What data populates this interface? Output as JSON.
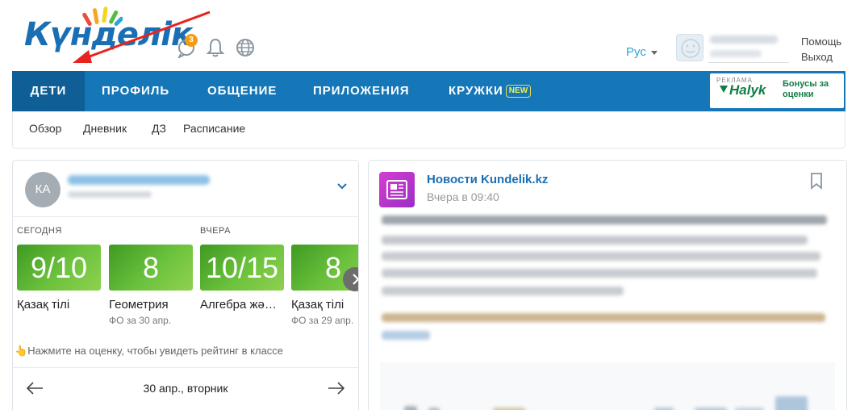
{
  "header": {
    "logo_text": "Күнделік",
    "notification_count": "3",
    "language": "Рус",
    "help_link": "Помощь",
    "logout_link": "Выход"
  },
  "nav": {
    "items": [
      {
        "label": "ДЕТИ",
        "active": true
      },
      {
        "label": "ПРОФИЛЬ",
        "active": false
      },
      {
        "label": "ОБЩЕНИЕ",
        "active": false
      },
      {
        "label": "ПРИЛОЖЕНИЯ",
        "active": false
      },
      {
        "label": "КРУЖКИ",
        "active": false
      }
    ],
    "new_badge": "NEW"
  },
  "ad": {
    "label": "РЕКЛАМА",
    "brand": "Halyk",
    "text": "Бонусы за оценки"
  },
  "subnav": {
    "items": [
      "Обзор",
      "Дневник",
      "ДЗ",
      "Расписание"
    ]
  },
  "student": {
    "initials": "КА"
  },
  "grades": {
    "today_label": "СЕГОДНЯ",
    "yesterday_label": "ВЧЕРА",
    "items": [
      {
        "value": "9/10",
        "subject": "Қазақ тілі",
        "note": ""
      },
      {
        "value": "8",
        "subject": "Геометрия",
        "note": "ФО за 30 апр."
      },
      {
        "value": "10/15",
        "subject": "Алгебра жә…",
        "note": ""
      },
      {
        "value": "8",
        "subject": "Қазақ тілі",
        "note": "ФО за 29 апр."
      }
    ],
    "hint": "Нажмите на оценку, чтобы увидеть рейтинг в классе"
  },
  "day_nav": {
    "date": "30 апр., вторник"
  },
  "news": {
    "title": "Новости Kundelik.kz",
    "time": "Вчера в 09:40"
  },
  "colors": {
    "brand_blue": "#1677b8",
    "active_tab": "#0f5f96",
    "grade_green": "#6cc23d",
    "accent_orange": "#f39c12"
  }
}
